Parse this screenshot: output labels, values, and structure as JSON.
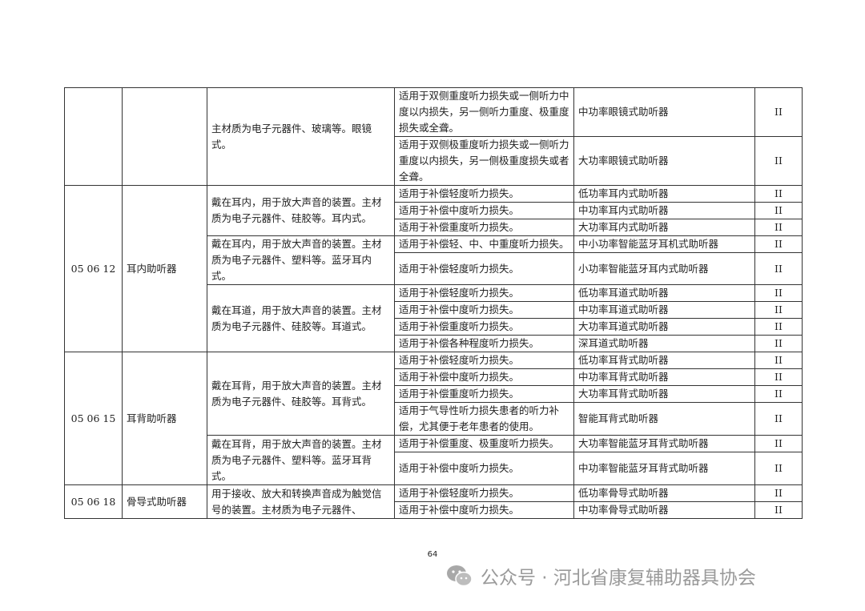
{
  "table": {
    "rows": [
      {
        "code": "",
        "name": "",
        "desc": "主材质为电子元器件、玻璃等。眼镜式。",
        "use": "适用于双侧重度听力损失或一侧听力中度以内损失，另一侧听力重度、极重度损失或全聋。",
        "product": "中功率眼镜式助听器",
        "class": "II"
      },
      {
        "use": "适用于双侧极重度听力损失或一侧听力重度以内损失，另一侧极重度损失或者全聋。",
        "product": "大功率眼镜式助听器",
        "class": "II"
      },
      {
        "code": "05 06 12",
        "name": "耳内助听器",
        "desc": "戴在耳内，用于放大声音的装置。主材质为电子元器件、硅胶等。耳内式。",
        "use": "适用于补偿轻度听力损失。",
        "product": "低功率耳内式助听器",
        "class": "II"
      },
      {
        "use": "适用于补偿中度听力损失。",
        "product": "中功率耳内式助听器",
        "class": "II"
      },
      {
        "use": "适用于补偿重度听力损失。",
        "product": "大功率耳内式助听器",
        "class": "II"
      },
      {
        "desc": "戴在耳内，用于放大声音的装置。主材质为电子元器件、塑料等。蓝牙耳内式。",
        "use": "适用于补偿轻、中、中重度听力损失。",
        "product": "中小功率智能蓝牙耳机式助听器",
        "class": "II"
      },
      {
        "use": "适用于补偿轻度听力损失。",
        "product": "小功率智能蓝牙耳内式助听器",
        "class": "II"
      },
      {
        "desc": "戴在耳道，用于放大声音的装置。主材质为电子元器件、硅胶等。耳道式。",
        "use": "适用于补偿轻度听力损失。",
        "product": "低功率耳道式助听器",
        "class": "II"
      },
      {
        "use": "适用于补偿中度听力损失。",
        "product": "中功率耳道式助听器",
        "class": "II"
      },
      {
        "use": "适用于补偿重度听力损失。",
        "product": "大功率耳道式助听器",
        "class": "II"
      },
      {
        "use": "适用于补偿各种程度听力损失。",
        "product": "深耳道式助听器",
        "class": "II"
      },
      {
        "code": "05 06 15",
        "name": "耳背助听器",
        "desc": "戴在耳背，用于放大声音的装置。主材质为电子元器件、硅胶等。耳背式。",
        "use": "适用于补偿轻度听力损失。",
        "product": "低功率耳背式助听器",
        "class": "II"
      },
      {
        "use": "适用于补偿中度听力损失。",
        "product": "中功率耳背式助听器",
        "class": "II"
      },
      {
        "use": "适用于补偿重度听力损失。",
        "product": "大功率耳背式助听器",
        "class": "II"
      },
      {
        "use": "适用于气导性听力损失患者的听力补偿，尤其便于老年患者的使用。",
        "product": "智能耳背式助听器",
        "class": "II"
      },
      {
        "desc": "戴在耳背，用于放大声音的装置。主材质为电子元器件、塑料等。蓝牙耳背式。",
        "use": "适用于补偿重度、极重度听力损失。",
        "product": "大功率智能蓝牙耳背式助听器",
        "class": "II"
      },
      {
        "use": "适用于补偿中度听力损失。",
        "product": "中功率智能蓝牙耳背式助听器",
        "class": "II"
      },
      {
        "code": "05 06 18",
        "name": "骨导式助听器",
        "desc": "用于接收、放大和转换声音成为触觉信号的装置。主材质为电子元器件、",
        "use": "适用于补偿轻度听力损失。",
        "product": "低功率骨导式助听器",
        "class": "II"
      },
      {
        "use": "适用于补偿中度听力损失。",
        "product": "中功率骨导式助听器",
        "class": "II"
      }
    ]
  },
  "page_number": "64",
  "watermark": {
    "text": "公众号 · 河北省康复辅助器具协会",
    "icon": "wechat-icon",
    "color": "#9a9a9a"
  }
}
